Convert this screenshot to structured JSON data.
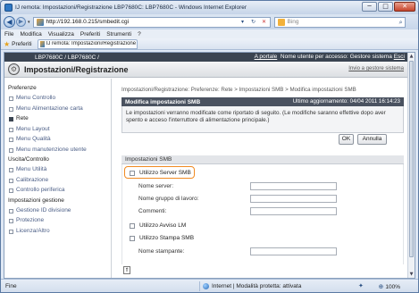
{
  "window": {
    "title": "IJ remota: Impostazioni/Registrazione LBP7680C: LBP7680C - Windows Internet Explorer",
    "minimize_glyph": "─",
    "maximize_glyph": "□",
    "close_glyph": "✕"
  },
  "addressbar": {
    "url": "http://192.168.0.215/smbedit.cgi",
    "search_placeholder": "Bing",
    "back_glyph": "◀",
    "forward_glyph": "▶",
    "dropdown_glyph": "▾",
    "refresh_glyph": "↻",
    "compat_glyph": "▾",
    "stop_glyph": "✕",
    "search_glyph": "⌕"
  },
  "menubar": {
    "items": [
      "File",
      "Modifica",
      "Visualizza",
      "Preferiti",
      "Strumenti",
      "?"
    ]
  },
  "favorites": {
    "label": "Preferiti",
    "star_glyph": "★",
    "tab_label": "IJ remota: Impostazioni/Registrazione LBP7680C:..."
  },
  "printer_bar": {
    "model": "LBP7680C / LBP7680C /",
    "portal_link": "A portale",
    "user_label": "Nome utente per accesso: Gestore sistema",
    "logout_link": "Esci"
  },
  "app_header": {
    "title": "Impostazioni/Registrazione",
    "manager_link": "Invio a gestore sistema",
    "logo_glyph": "⚙"
  },
  "sidebar": {
    "sections": [
      {
        "title": "Preferenze",
        "items": [
          {
            "label": "Menu Controllo",
            "active": false
          },
          {
            "label": "Menu Alimentazione carta",
            "active": false
          },
          {
            "label": "Rete",
            "active": true
          },
          {
            "label": "Menu Layout",
            "active": false
          },
          {
            "label": "Menu Qualità",
            "active": false
          },
          {
            "label": "Menu manutenzione utente",
            "active": false
          }
        ]
      },
      {
        "title": "Uscita/Controllo",
        "items": [
          {
            "label": "Menu Utilità",
            "active": false
          },
          {
            "label": "Calibrazione",
            "active": false
          },
          {
            "label": "Controllo periferica",
            "active": false
          }
        ]
      },
      {
        "title": "Impostazioni gestione",
        "items": [
          {
            "label": "Gestione ID divisione",
            "active": false
          },
          {
            "label": "Protezione",
            "active": false
          },
          {
            "label": "Licenza/Altro",
            "active": false
          }
        ]
      }
    ]
  },
  "main": {
    "breadcrumb": "Impostazioni/Registrazione: Preferenze: Rete > Impostazioni SMB > Modifica impostazioni SMB",
    "panel_title": "Modifica impostazioni SMB",
    "last_updated": "Ultimo aggiornamento: 04/04 2011 16:14:23",
    "info_text": "Le impostazioni verranno modificate come riportato di seguito. (Le modifiche saranno effettive dopo aver spento e acceso l'interruttore di alimentazione principale.)",
    "ok_label": "OK",
    "cancel_label": "Annulla",
    "section_title": "Impostazioni SMB",
    "use_smb_server_label": "Utilizzo Server SMB",
    "server_name_label": "Nome server:",
    "server_name_value": "",
    "workgroup_label": "Nome gruppo di lavoro:",
    "workgroup_value": "",
    "comment_label": "Commenti:",
    "comment_value": "",
    "lm_notice_label": "Utilizzo Avviso LM",
    "smb_print_label": "Utilizzo Stampa SMB",
    "printer_name_label": "Nome stampante:",
    "printer_name_value": "",
    "top_glyph": "⇑"
  },
  "statusbar": {
    "left_text": "Fine",
    "zone_text": "Internet | Modalità protetta: attivata",
    "zoom_text": "100%",
    "zoom_glyph": "⊕",
    "protect_glyph": "✦"
  }
}
